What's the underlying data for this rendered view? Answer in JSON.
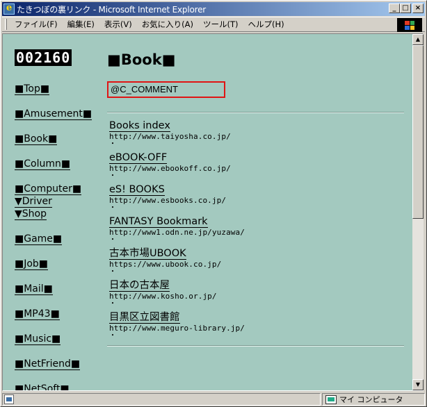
{
  "window": {
    "title": "たきつぼの裏リンク - Microsoft Internet Explorer",
    "buttons": {
      "minimize": "_",
      "maximize": "□",
      "close": "×"
    }
  },
  "menu": [
    "ファイル(F)",
    "編集(E)",
    "表示(V)",
    "お気に入り(A)",
    "ツール(T)",
    "ヘルプ(H)"
  ],
  "sidebar": {
    "counter": "002160",
    "items": [
      {
        "label": "■Top■"
      },
      {
        "label": "■Amusement■"
      },
      {
        "label": "■Book■"
      },
      {
        "label": "■Column■"
      },
      {
        "label": "■Computer■"
      },
      {
        "label": "▼Driver"
      },
      {
        "label": "▼Shop"
      },
      {
        "label": "■Game■"
      },
      {
        "label": "■Job■"
      },
      {
        "label": "■Mail■"
      },
      {
        "label": "■MP43■"
      },
      {
        "label": "■Music■"
      },
      {
        "label": "■NetFriend■"
      },
      {
        "label": "■NetSoft■"
      }
    ]
  },
  "main": {
    "title": "■Book■",
    "comment": "@C_COMMENT",
    "links": [
      {
        "title": "Books index",
        "url": "http://www.taiyosha.co.jp/",
        "dot": "・"
      },
      {
        "title": "eBOOK-OFF",
        "url": "http://www.ebookoff.co.jp/",
        "dot": "・"
      },
      {
        "title": "eS! BOOKS",
        "url": "http://www.esbooks.co.jp/",
        "dot": "・"
      },
      {
        "title": "FANTASY Bookmark",
        "url": "http://www1.odn.ne.jp/yuzawa/",
        "dot": "・"
      },
      {
        "title": "古本市場UBOOK",
        "url": "https://www.ubook.co.jp/",
        "dot": "・"
      },
      {
        "title": "日本の古本屋",
        "url": "http://www.kosho.or.jp/",
        "dot": "・"
      },
      {
        "title": "目黒区立図書館",
        "url": "http://www.meguro-library.jp/",
        "dot": "・"
      }
    ]
  },
  "status": {
    "main": "",
    "zone": "マイ コンピュータ"
  },
  "colors": {
    "page_bg": "#a3c9bf",
    "titlebar": "#0a246a",
    "highlight_box": "#e01414"
  }
}
